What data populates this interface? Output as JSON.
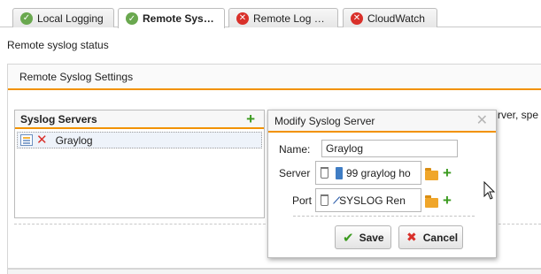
{
  "tabs": [
    {
      "label": "Local Logging",
      "status": "ok"
    },
    {
      "label": "Remote Sys…",
      "status": "ok",
      "active": true
    },
    {
      "label": "Remote Log …",
      "status": "error"
    },
    {
      "label": "CloudWatch",
      "status": "error"
    }
  ],
  "page": {
    "status_title": "Remote syslog status",
    "panel_title": "Remote Syslog Settings",
    "background_text": "rver, spe"
  },
  "servers": {
    "title": "Syslog Servers",
    "add_icon": "plus-icon",
    "items": [
      {
        "name": "Graylog"
      }
    ]
  },
  "modal": {
    "title": "Modify Syslog Server",
    "close_icon": "close-icon",
    "name_label": "Name:",
    "name_value": "Graylog",
    "server_label": "Server",
    "server_value": "99 graylog ho",
    "port_label": "Port",
    "port_value": "SYSLOG Ren",
    "save_label": "Save",
    "cancel_label": "Cancel"
  },
  "colors": {
    "accent": "#f29200",
    "ok": "#6aa84f",
    "error": "#d9302a",
    "add": "#3a9a1e"
  }
}
